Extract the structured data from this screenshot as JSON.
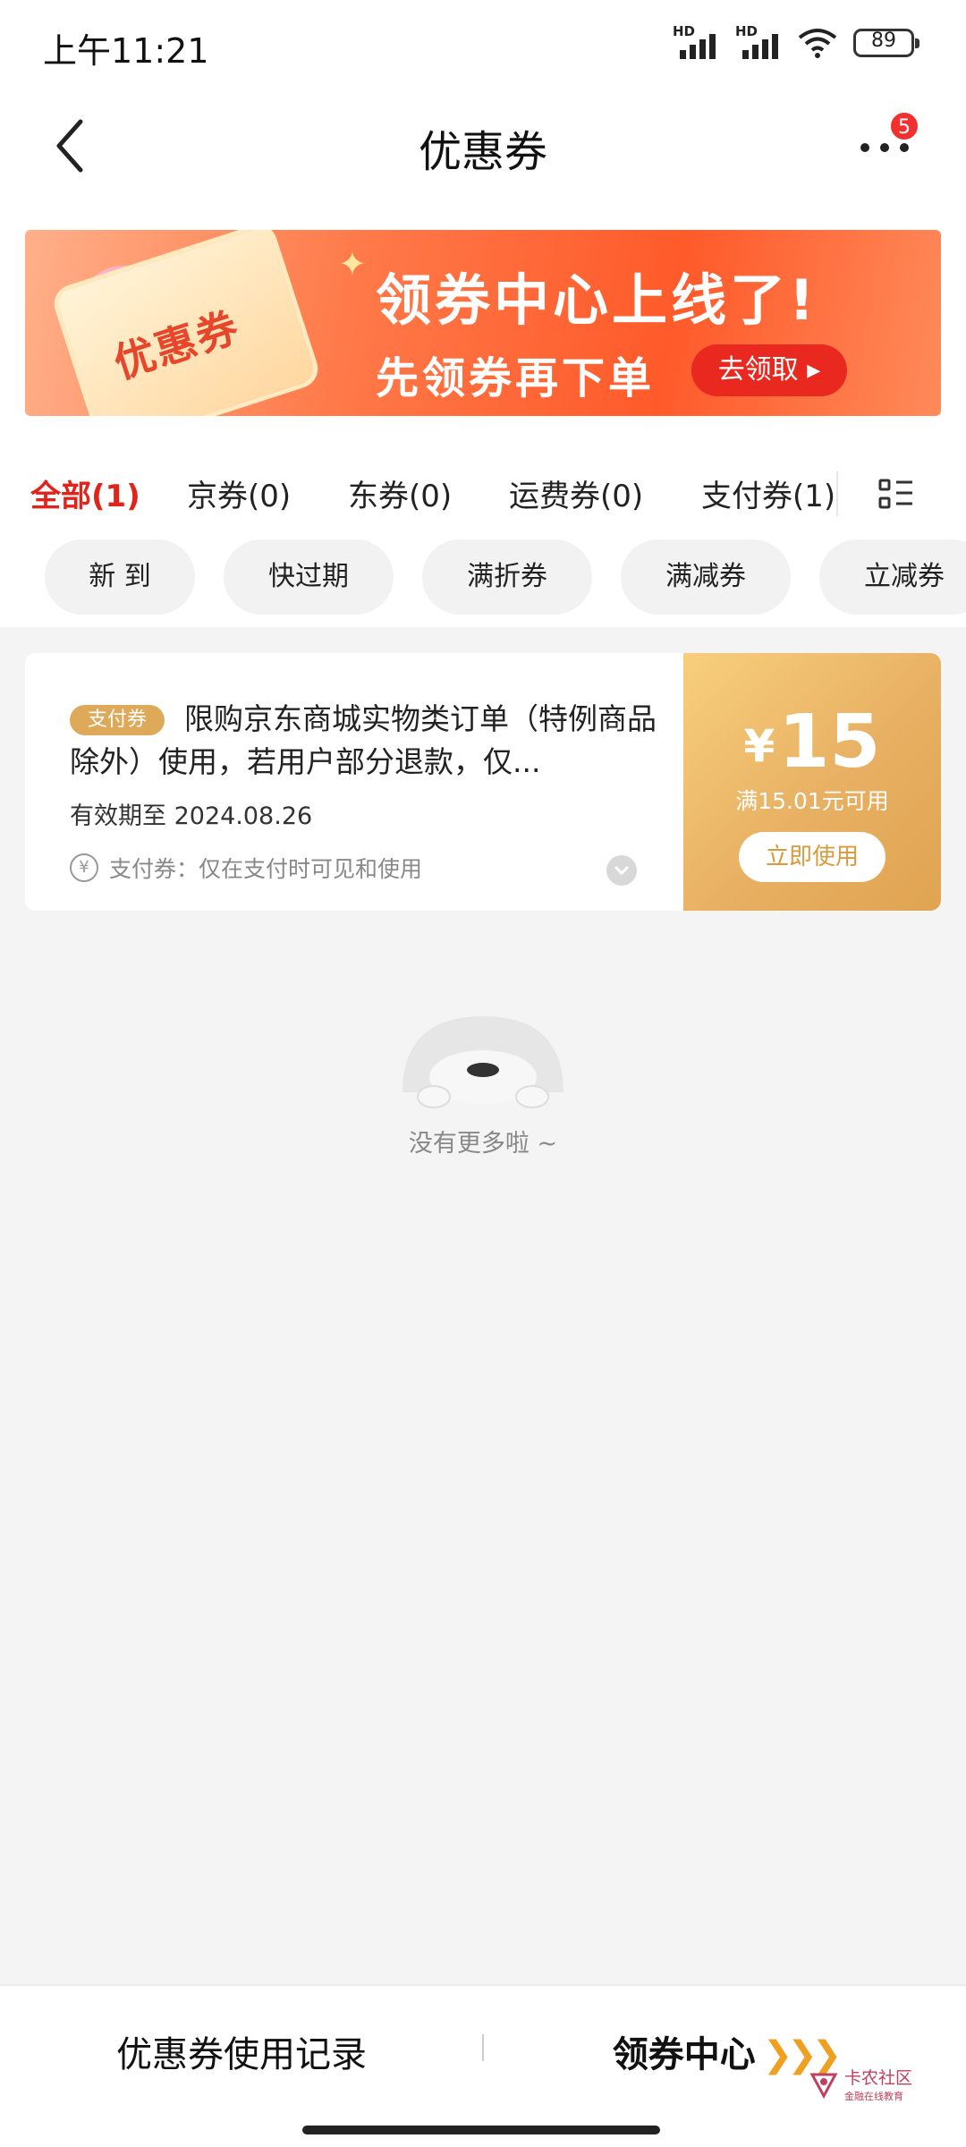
{
  "status": {
    "time": "上午11:21",
    "signal_label": "HD",
    "battery": "89"
  },
  "nav": {
    "title": "优惠券",
    "more_badge": "5"
  },
  "banner": {
    "coupon_text": "优惠券",
    "headline": "领券中心上线了!",
    "sub": "先领券再下单",
    "button": "去领取 ▸",
    "page_count": 4,
    "active_page": 1
  },
  "tabs": [
    {
      "label": "全部(1)",
      "active": true
    },
    {
      "label": "京券(0)",
      "active": false
    },
    {
      "label": "东券(0)",
      "active": false
    },
    {
      "label": "运费券(0)",
      "active": false
    },
    {
      "label": "支付券(1)",
      "active": false
    }
  ],
  "filters": [
    "新 到",
    "快过期",
    "满折券",
    "满减券",
    "立减券"
  ],
  "coupon": {
    "tag": "支付券",
    "description": "限购京东商城实物类订单（特例商品除外）使用，若用户部分退款，仅...",
    "expiry": "有效期至 2024.08.26",
    "note": "支付券：仅在支付时可见和使用",
    "currency": "¥",
    "amount": "15",
    "condition": "满15.01元可用",
    "use_button": "立即使用",
    "colors": {
      "tag": "#deaa5a",
      "panel": "#e8b063"
    }
  },
  "empty": {
    "text": "没有更多啦 ~"
  },
  "bottom": {
    "left_label": "优惠券使用记录",
    "right_label": "领券中心",
    "right_arrows": "❯❯❯"
  },
  "watermark": {
    "title": "卡农社区",
    "subtitle": "金融在线教育"
  },
  "colors": {
    "accent": "#e2231a",
    "badge": "#f23030"
  }
}
